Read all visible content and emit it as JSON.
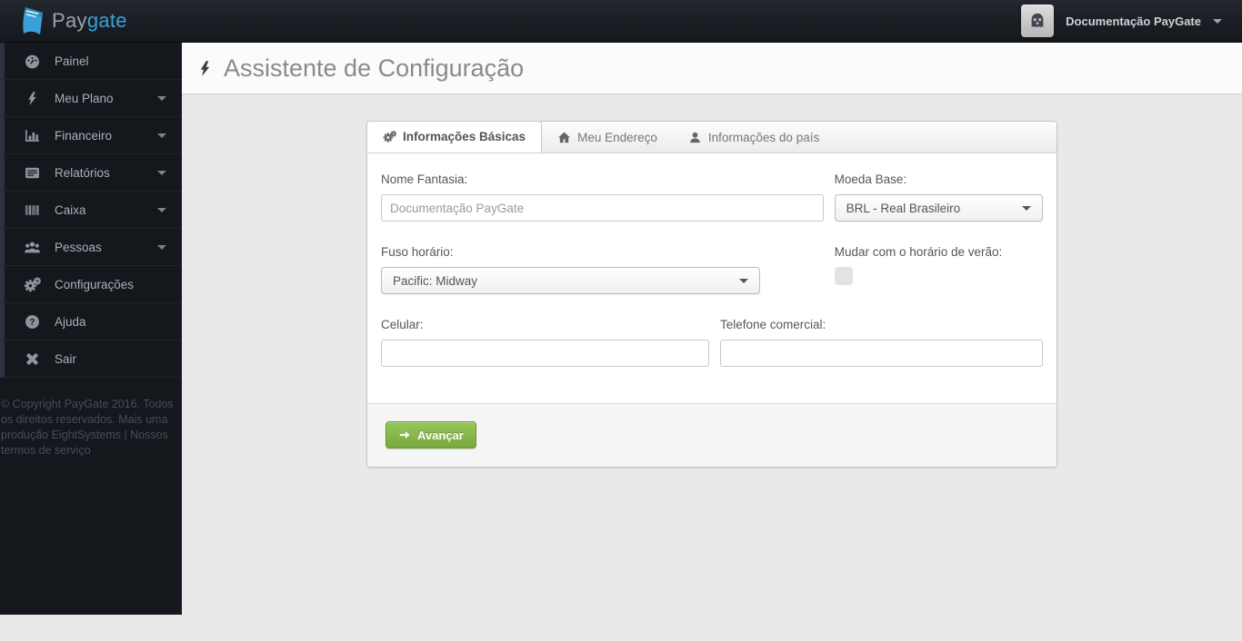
{
  "navbar": {
    "brand": {
      "pay": "Pay",
      "gate": "gate"
    },
    "user_menu_label": "Documentação PayGate"
  },
  "page_header": {
    "title": "Assistente de Configuração"
  },
  "sidebar": {
    "items": [
      {
        "label": "Painel",
        "icon": "tachometer-icon",
        "caret": false
      },
      {
        "label": "Meu Plano",
        "icon": "bolt-icon",
        "caret": true
      },
      {
        "label": "Financeiro",
        "icon": "bar-chart-icon",
        "caret": true
      },
      {
        "label": "Relatórios",
        "icon": "report-icon",
        "caret": true
      },
      {
        "label": "Caixa",
        "icon": "barcode-icon",
        "caret": true
      },
      {
        "label": "Pessoas",
        "icon": "users-icon",
        "caret": true
      },
      {
        "label": "Configurações",
        "icon": "gears-icon",
        "caret": false
      },
      {
        "label": "Ajuda",
        "icon": "help-icon",
        "caret": false
      },
      {
        "label": "Sair",
        "icon": "close-icon",
        "caret": false
      }
    ],
    "footer_text": "© Copyright PayGate 2016. Todos os direitos reservados. Mais uma produção EightSystems | Nossos termos de serviço"
  },
  "wizard": {
    "tabs": [
      {
        "label": "Informações Básicas",
        "icon": "gears-icon",
        "active": true
      },
      {
        "label": "Meu Endereço",
        "icon": "home-icon",
        "active": false
      },
      {
        "label": "Informações do país",
        "icon": "user-icon",
        "active": false
      }
    ],
    "form": {
      "nome_fantasia_label": "Nome Fantasia:",
      "nome_fantasia_value": "Documentação PayGate",
      "moeda_base_label": "Moeda Base:",
      "moeda_base_value": "BRL - Real Brasileiro",
      "fuso_label": "Fuso horário:",
      "fuso_value": "Pacific: Midway",
      "verao_label": "Mudar com o horário de verão:",
      "verao_checked": false,
      "celular_label": "Celular:",
      "celular_value": "",
      "telefone_label": "Telefone comercial:",
      "telefone_value": ""
    },
    "submit_label": "Avançar"
  },
  "colors": {
    "brand_blue": "#3aa1d8",
    "navbar_bg": "#171b21",
    "sidebar_bg": "#14171c",
    "content_bg": "#e9e9e9",
    "button_green": "#7aa93d",
    "accent_strip": "#2a3240"
  }
}
